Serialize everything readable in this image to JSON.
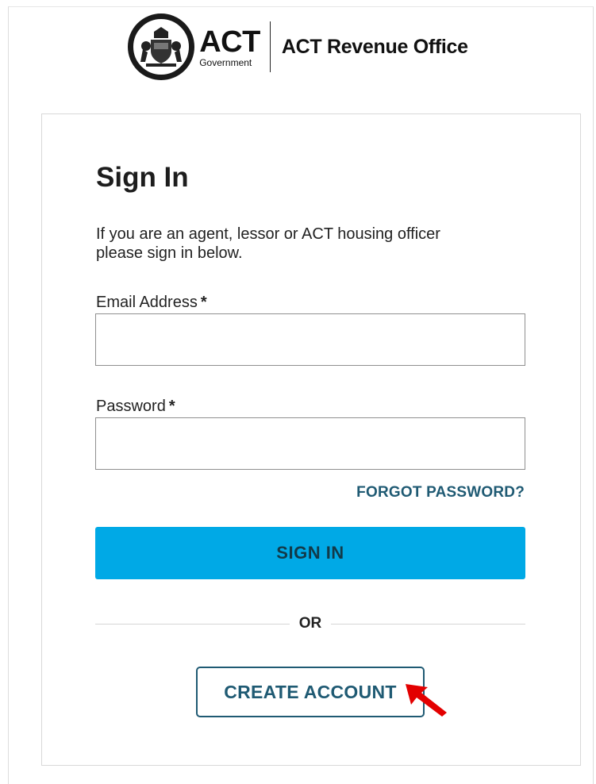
{
  "header": {
    "logo_text": "ACT",
    "logo_subtext": "Government",
    "office_name": "ACT Revenue Office"
  },
  "signin": {
    "title": "Sign In",
    "intro_line1": "If you are an agent, lessor or ACT housing officer",
    "intro_line2": "please sign in below.",
    "email_label": "Email Address",
    "email_value": "",
    "password_label": "Password",
    "password_value": "",
    "required_marker": "*",
    "forgot_link": "FORGOT PASSWORD?",
    "signin_button": "SIGN IN",
    "or_text": "OR",
    "create_account_button": "CREATE ACCOUNT"
  },
  "colors": {
    "primary_button": "#00a9e6",
    "link": "#1f5a73",
    "annotation_arrow": "#e30000"
  },
  "icons": {
    "crest": "act-coat-of-arms-icon",
    "annotation": "red-arrow-pointer-icon"
  }
}
